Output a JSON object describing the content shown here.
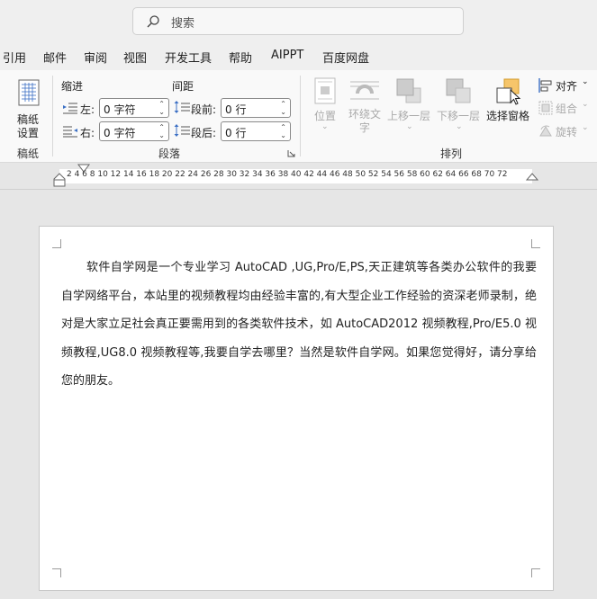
{
  "search": {
    "placeholder": "搜索"
  },
  "tabs": [
    "引用",
    "邮件",
    "审阅",
    "视图",
    "开发工具",
    "帮助",
    "AIPPT",
    "百度网盘"
  ],
  "manuscript": {
    "button": "稿纸\n设置",
    "group": "稿纸"
  },
  "paragraph": {
    "indent_header": "缩进",
    "spacing_header": "间距",
    "left_label": "左:",
    "right_label": "右:",
    "before_label": "段前:",
    "after_label": "段后:",
    "left_value": "0 字符",
    "right_value": "0 字符",
    "before_value": "0 行",
    "after_value": "0 行",
    "group": "段落"
  },
  "arrange": {
    "position": "位置",
    "wrap_text": "环绕文\n字",
    "bring_forward": "上移一层",
    "send_backward": "下移一层",
    "selection_pane": "选择窗格",
    "align": "对齐",
    "group_btn": "组合",
    "rotate": "旋转",
    "group": "排列"
  },
  "ruler": {
    "numbers": "2  4  6  8  10 12 14 16 18 20 22 24 26 28 30 32 34 36 38 40 42 44 46 48 50 52 54 56 58 60 62 64 66 68 70 72"
  },
  "document": {
    "text": "软件自学网是一个专业学习 AutoCAD ,UG,Pro/E,PS,天正建筑等各类办公软件的我要自学网络平台，本站里的视频教程均由经验丰富的,有大型企业工作经验的资深老师录制，绝对是大家立足社会真正要需用到的各类软件技术，如 AutoCAD2012 视频教程,Pro/E5.0 视频教程,UG8.0 视频教程等,我要自学去哪里？当然是软件自学网。如果您觉得好，请分享给您的朋友。"
  }
}
